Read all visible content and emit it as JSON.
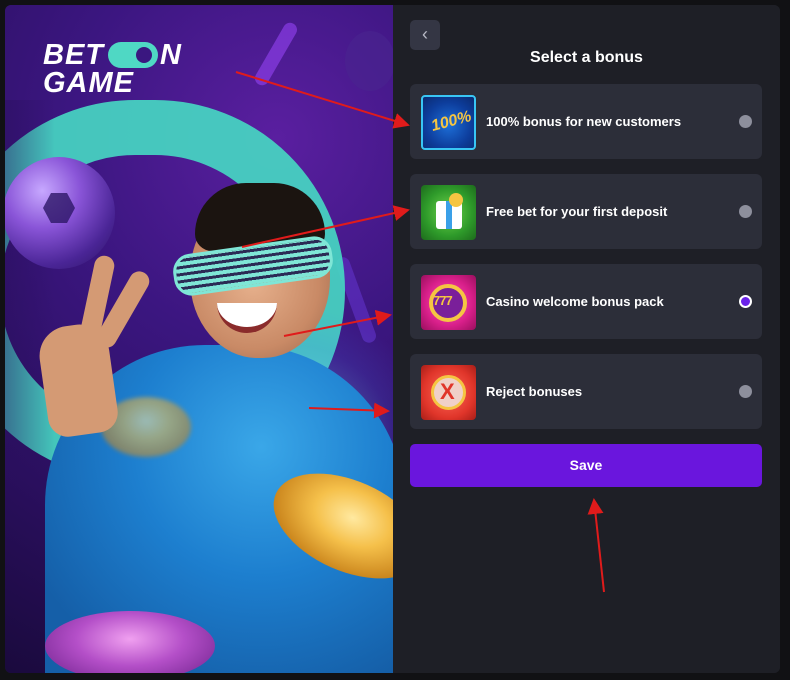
{
  "brand": {
    "line1_a": "BET",
    "line1_b": "N",
    "line2": "GAME"
  },
  "panel": {
    "title": "Select a bonus",
    "back_icon": "‹"
  },
  "options": [
    {
      "label": "100% bonus for new customers",
      "icon": "percent-ball-icon",
      "thumb_text": "100%",
      "selected": false
    },
    {
      "label": "Free bet for your first deposit",
      "icon": "gift-icon",
      "selected": false
    },
    {
      "label": "Casino welcome bonus pack",
      "icon": "slot-wheel-icon",
      "thumb_text": "777",
      "selected": true
    },
    {
      "label": "Reject bonuses",
      "icon": "reject-icon",
      "thumb_text": "X",
      "selected": false
    }
  ],
  "save": {
    "label": "Save"
  },
  "colors": {
    "accent": "#6a16dd",
    "panel_bg": "#1e1f26",
    "card_bg": "#2c2e39",
    "arrow": "#e01b1b"
  }
}
